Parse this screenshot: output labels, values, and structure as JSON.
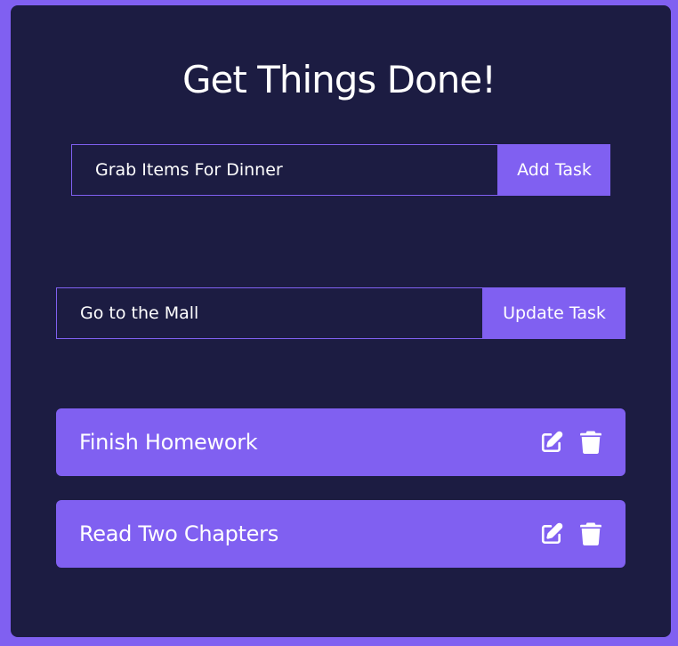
{
  "app": {
    "title": "Get Things Done!"
  },
  "add_form": {
    "input_value": "Grab Items For Dinner",
    "button_label": "Add Task"
  },
  "edit_form": {
    "input_value": "Go to the Mall",
    "button_label": "Update Task"
  },
  "todos": [
    {
      "label": "Finish Homework",
      "icons": [
        "edit-icon",
        "trash-icon"
      ]
    },
    {
      "label": "Read Two Chapters",
      "icons": [
        "edit-icon",
        "trash-icon"
      ]
    }
  ],
  "colors": {
    "background": "#8060f1",
    "card": "#1c1c42",
    "accent": "#8060f1",
    "text": "#ffffff"
  }
}
